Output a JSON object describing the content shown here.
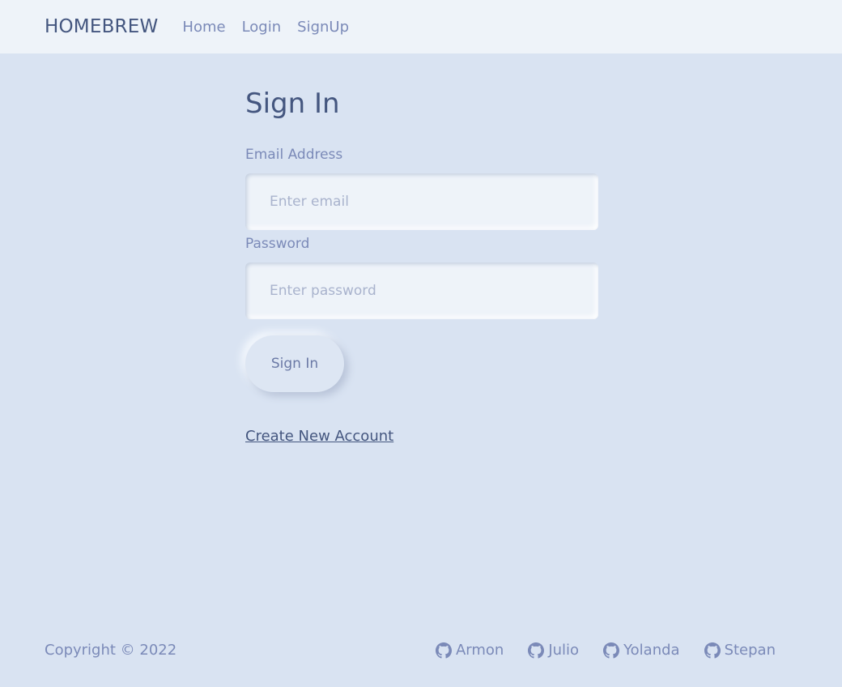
{
  "navbar": {
    "brand": "HOMEBREW",
    "links": [
      "Home",
      "Login",
      "SignUp"
    ]
  },
  "form": {
    "title": "Sign In",
    "email_label": "Email Address",
    "email_placeholder": "Enter email",
    "email_value": "",
    "password_label": "Password",
    "password_placeholder": "Enter password",
    "password_value": "",
    "submit_label": "Sign In",
    "create_account_label": "Create New Account"
  },
  "footer": {
    "copyright": "Copyright © 2022",
    "contributors": [
      {
        "name": "Armon",
        "icon": "github-icon"
      },
      {
        "name": "Julio",
        "icon": "github-icon"
      },
      {
        "name": "Yolanda",
        "icon": "github-icon"
      },
      {
        "name": "Stepan",
        "icon": "github-icon"
      }
    ]
  },
  "colors": {
    "background": "#d9e3f2",
    "navbar": "#eef3f9",
    "text_dark": "#44567f",
    "text_muted": "#7b8ab8"
  }
}
